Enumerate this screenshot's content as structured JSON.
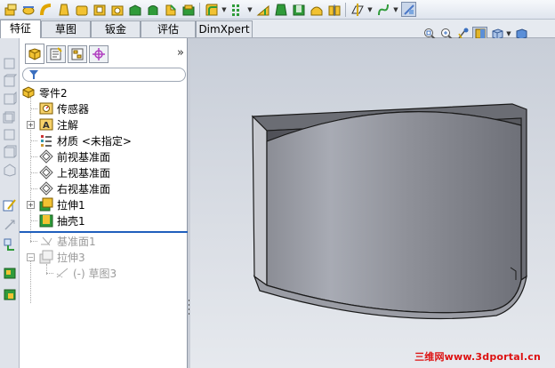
{
  "command_tabs": [
    {
      "label": "特征",
      "active": true
    },
    {
      "label": "草图",
      "active": false
    },
    {
      "label": "钣金",
      "active": false
    },
    {
      "label": "评估",
      "active": false
    },
    {
      "label": "DimXpert",
      "active": false
    }
  ],
  "toolbar": {
    "icons": [
      "extruded-boss-icon",
      "revolved-boss-icon",
      "swept-boss-icon",
      "lofted-boss-icon",
      "boundary-boss-icon",
      "extruded-cut-icon",
      "hole-wizard-icon",
      "revolved-cut-icon",
      "swept-cut-icon",
      "lofted-cut-icon",
      "boundary-cut-icon",
      "fillet-icon",
      "linear-pattern-icon",
      "rib-icon",
      "draft-icon",
      "shell-icon",
      "dome-icon",
      "mirror-icon",
      "reference-geometry-icon",
      "curves-icon",
      "instant3d-icon"
    ]
  },
  "view_toolbar": {
    "icons": [
      "zoom-to-fit-icon",
      "zoom-to-area-icon",
      "previous-view-icon",
      "section-view-icon",
      "view-orientation-icon",
      "display-style-icon"
    ]
  },
  "feature_manager": {
    "tabs": [
      "feature-manager-tab-icon",
      "property-manager-tab-icon",
      "configuration-manager-tab-icon",
      "dimxpert-manager-tab-icon"
    ],
    "expand_glyph": "»",
    "filter_icon": "filter-icon",
    "root_label": "零件2",
    "items": [
      {
        "label": "传感器",
        "icon": "sensor-icon"
      },
      {
        "label": "注解",
        "icon": "annotations-icon",
        "expandable": true
      },
      {
        "label": "材质 <未指定>",
        "icon": "material-icon"
      },
      {
        "label": "前视基准面",
        "icon": "plane-icon"
      },
      {
        "label": "上视基准面",
        "icon": "plane-icon"
      },
      {
        "label": "右视基准面",
        "icon": "plane-icon"
      },
      {
        "label": "拉伸1",
        "icon": "extrude-feature-icon",
        "expandable": true
      },
      {
        "label": "抽壳1",
        "icon": "shell-feature-icon"
      },
      {
        "label": "基准面1",
        "icon": "plane-icon",
        "suppressed": true
      },
      {
        "label": "拉伸3",
        "icon": "extrude-feature-icon",
        "suppressed": true,
        "expanded": true
      },
      {
        "label": "(-) 草图3",
        "icon": "sketch-icon",
        "suppressed": true
      }
    ]
  },
  "watermark": "三维网www.3dportal.cn",
  "colors": {
    "model_body": "#7e8088",
    "background_top": "#c8ced8",
    "background_bottom": "#e6e9ee",
    "rollback_bar": "#1f5fbd",
    "watermark": "#dd1111"
  }
}
